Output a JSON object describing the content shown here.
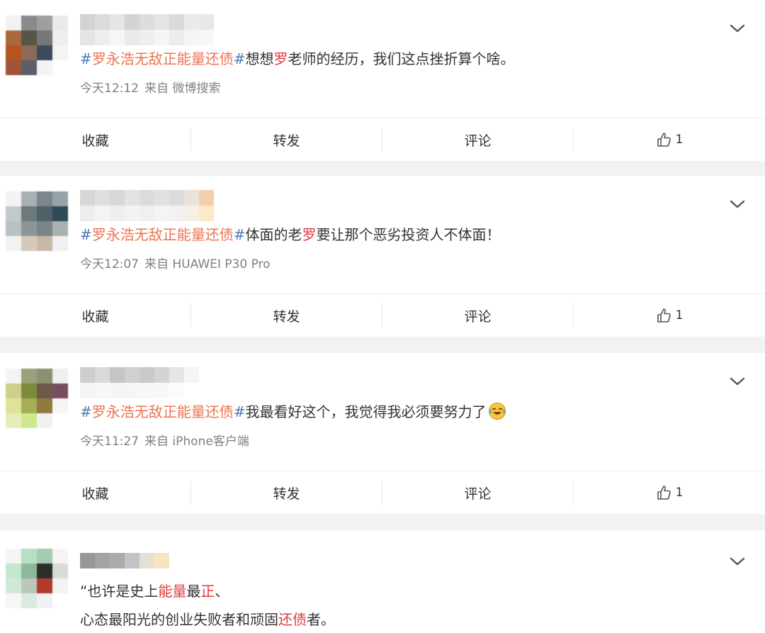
{
  "actions": {
    "favorite": "收藏",
    "repost": "转发",
    "comment": "评论"
  },
  "posts": [
    {
      "topic_hash_open": "#",
      "topic": "罗永浩无敌正能量还债",
      "topic_hash_close": "#",
      "text_a": "想想",
      "text_hl": "罗",
      "text_b": "老师的经历，我们这点挫折算个啥。",
      "time": "今天12:12",
      "source": "来自 微博搜索",
      "likes": "1"
    },
    {
      "topic_hash_open": "#",
      "topic": "罗永浩无敌正能量还债",
      "topic_hash_close": "#",
      "text_a": "体面的老",
      "text_hl": "罗",
      "text_b": "要让那个恶劣投资人不体面！",
      "time": "今天12:07",
      "source": "来自 HUAWEI P30 Pro",
      "likes": "1"
    },
    {
      "topic_hash_open": "#",
      "topic": "罗永浩无敌正能量还债",
      "topic_hash_close": "#",
      "text_a": "我最看好这个，我觉得我必须要努力了",
      "emoji": "crying-laughing-emoji",
      "time": "今天11:27",
      "source": "来自 iPhone客户端",
      "likes": "1"
    },
    {
      "line1_a": "“也许是史上",
      "line1_hl1": "能量",
      "line1_b": "最",
      "line1_hl2": "正",
      "line1_c": "、",
      "line2_a": "心态最阳光的创业失败者和顽固",
      "line2_hl": "还债",
      "line2_b": "者。"
    }
  ],
  "colors": {
    "hashtag": "#5079b6",
    "topic": "#eb7350",
    "keyword": "#e0393e",
    "meta": "#808080"
  },
  "icons": [
    "chevron-down-icon",
    "thumbs-up-icon"
  ]
}
